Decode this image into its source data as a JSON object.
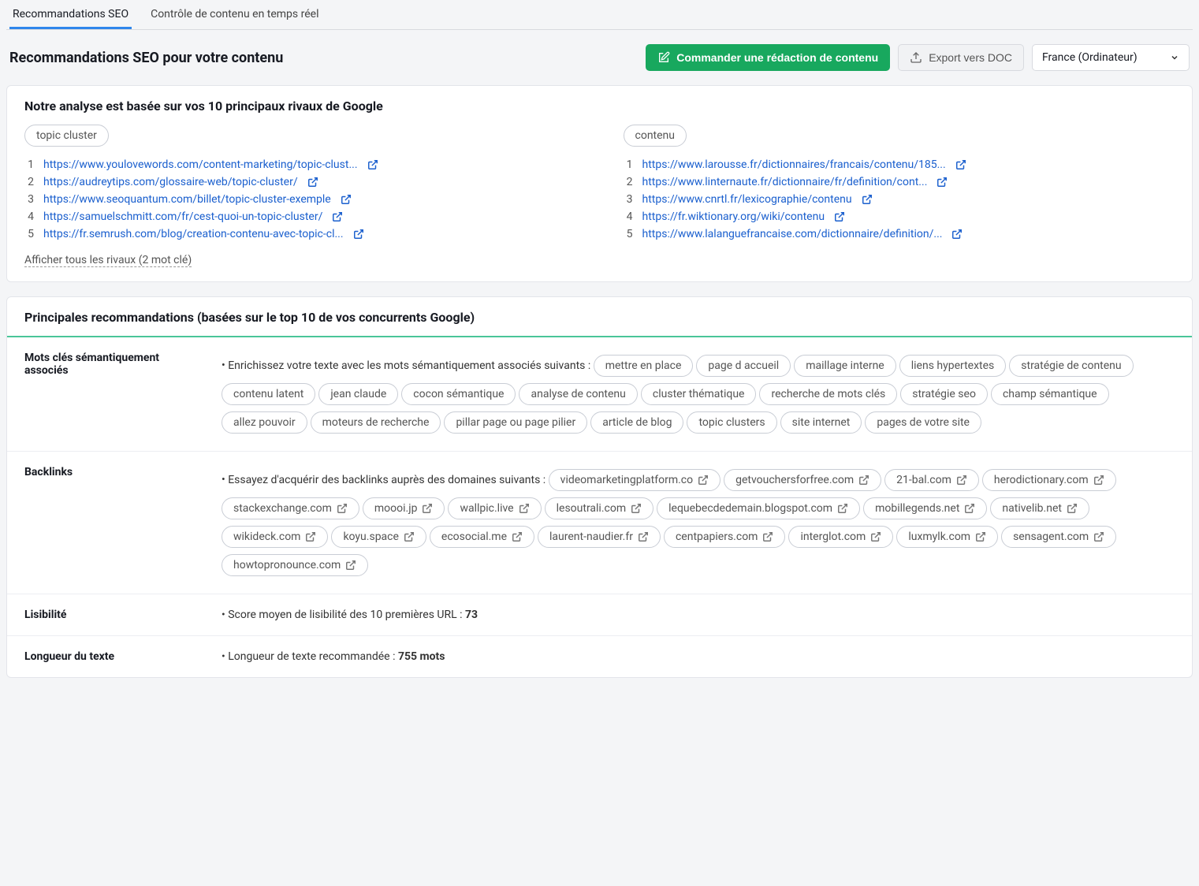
{
  "tabs": {
    "active": "Recommandations SEO",
    "other": "Contrôle de contenu en temps réel"
  },
  "header": {
    "title": "Recommandations SEO pour votre contenu",
    "order_btn": "Commander une rédaction de contenu",
    "export_btn": "Export vers DOC",
    "region_select": "France (Ordinateur)"
  },
  "rivals": {
    "title": "Notre analyse est basée sur vos 10 principaux rivaux de Google",
    "cols": [
      {
        "keyword": "topic cluster",
        "items": [
          "https://www.youlovewords.com/content-marketing/topic-clust...",
          "https://audreytips.com/glossaire-web/topic-cluster/",
          "https://www.seoquantum.com/billet/topic-cluster-exemple",
          "https://samuelschmitt.com/fr/cest-quoi-un-topic-cluster/",
          "https://fr.semrush.com/blog/creation-contenu-avec-topic-cl..."
        ]
      },
      {
        "keyword": "contenu",
        "items": [
          "https://www.larousse.fr/dictionnaires/francais/contenu/185...",
          "https://www.linternaute.fr/dictionnaire/fr/definition/cont...",
          "https://www.cnrtl.fr/lexicographie/contenu",
          "https://fr.wiktionary.org/wiki/contenu",
          "https://www.lalanguefrancaise.com/dictionnaire/definition/..."
        ]
      }
    ],
    "show_all": "Afficher tous les rivaux (2 mot clé)"
  },
  "reco": {
    "title": "Principales recommandations (basées sur le top 10 de vos concurrents Google)",
    "semantic": {
      "label": "Mots clés sémantiquement associés",
      "lead": "Enrichissez votre texte avec les mots sémantiquement associés suivants :",
      "tags": [
        "mettre en place",
        "page d accueil",
        "maillage interne",
        "liens hypertextes",
        "stratégie de contenu",
        "contenu latent",
        "jean claude",
        "cocon sémantique",
        "analyse de contenu",
        "cluster thématique",
        "recherche de mots clés",
        "stratégie seo",
        "champ sémantique",
        "allez pouvoir",
        "moteurs de recherche",
        "pillar page ou page pilier",
        "article de blog",
        "topic clusters",
        "site internet",
        "pages de votre site"
      ]
    },
    "backlinks": {
      "label": "Backlinks",
      "lead": "Essayez d'acquérir des backlinks auprès des domaines suivants :",
      "tags": [
        "videomarketingplatform.co",
        "getvouchersforfree.com",
        "21-bal.com",
        "herodictionary.com",
        "stackexchange.com",
        "moooi.jp",
        "wallpic.live",
        "lesoutrali.com",
        "lequebecdedemain.blogspot.com",
        "mobillegends.net",
        "nativelib.net",
        "wikideck.com",
        "koyu.space",
        "ecosocial.me",
        "laurent-naudier.fr",
        "centpapiers.com",
        "interglot.com",
        "luxmylk.com",
        "sensagent.com",
        "howtopronounce.com"
      ]
    },
    "readability": {
      "label": "Lisibilité",
      "lead": "Score moyen de lisibilité des 10 premières URL : ",
      "value": "73"
    },
    "length": {
      "label": "Longueur du texte",
      "lead": "Longueur de texte recommandée : ",
      "value": "755 mots"
    }
  }
}
